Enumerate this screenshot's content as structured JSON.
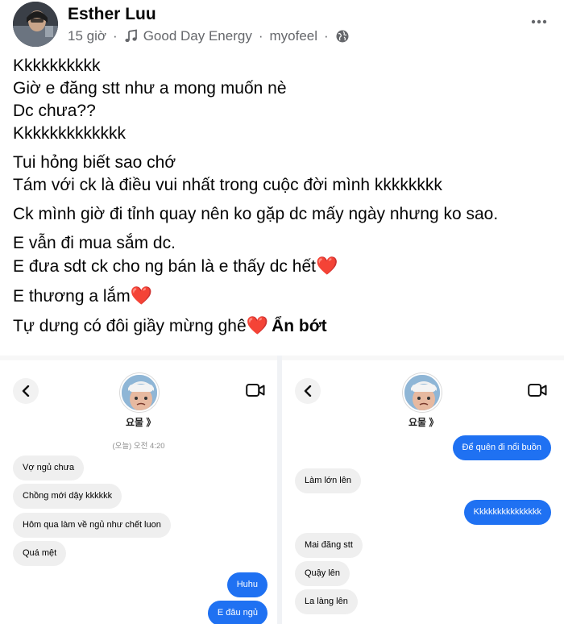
{
  "post": {
    "author": "Esther Luu",
    "time": "15 giờ",
    "music": "Good Day Energy",
    "music_artist": "myofeel",
    "more_icon": "more-horizontal-icon",
    "privacy_icon": "globe-icon",
    "paragraphs": [
      [
        "Kkkkkkkkkk",
        "Giờ e đăng stt như a mong muốn nè",
        "Dc chưa??",
        "Kkkkkkkkkkkkk"
      ],
      [
        "Tui hỏng biết sao chớ",
        "Tám với ck là điều vui nhất trong cuộc đời mình kkkkkkkk"
      ],
      [
        "Ck mình giờ đi tỉnh quay nên ko gặp dc mấy ngày nhưng ko sao."
      ],
      [
        "E vẫn đi mua sắm dc.",
        "E đưa sdt ck cho ng bán là e thấy dc hết"
      ],
      [
        "E thương a lắm"
      ],
      [
        "Tự dưng có đôi giầy mừng ghê"
      ]
    ],
    "heart_emoji": "❤️",
    "see_less": "Ẩn bớt"
  },
  "chat_left": {
    "contact_name": "요물 》",
    "timestamp": "(오늘) 오전 4:20",
    "messages": [
      {
        "text": "Vợ ngủ chưa",
        "from": "in"
      },
      {
        "text": "Chồng mới dậy kkkkkk",
        "from": "in"
      },
      {
        "text": "Hôm qua làm về ngủ như chết luon",
        "from": "in"
      },
      {
        "text": "Quá mệt",
        "from": "in"
      },
      {
        "text": "Huhu",
        "from": "out"
      },
      {
        "text": "E đâu ngủ",
        "from": "out"
      }
    ]
  },
  "chat_right": {
    "contact_name": "요물 》",
    "messages": [
      {
        "text": "Để quên đi nổi buồn",
        "from": "out"
      },
      {
        "text": "Làm lớn lên",
        "from": "in"
      },
      {
        "text": "Kkkkkkkkkkkkkkk",
        "from": "out"
      },
      {
        "text": "Mai đăng stt",
        "from": "in"
      },
      {
        "text": "Quậy lên",
        "from": "in"
      },
      {
        "text": "La làng lên",
        "from": "in"
      }
    ]
  },
  "colors": {
    "outgoing_bubble": "#1f71f2",
    "incoming_bubble": "#efefef",
    "heart": "#e0182d",
    "meta_text": "#65676b"
  }
}
